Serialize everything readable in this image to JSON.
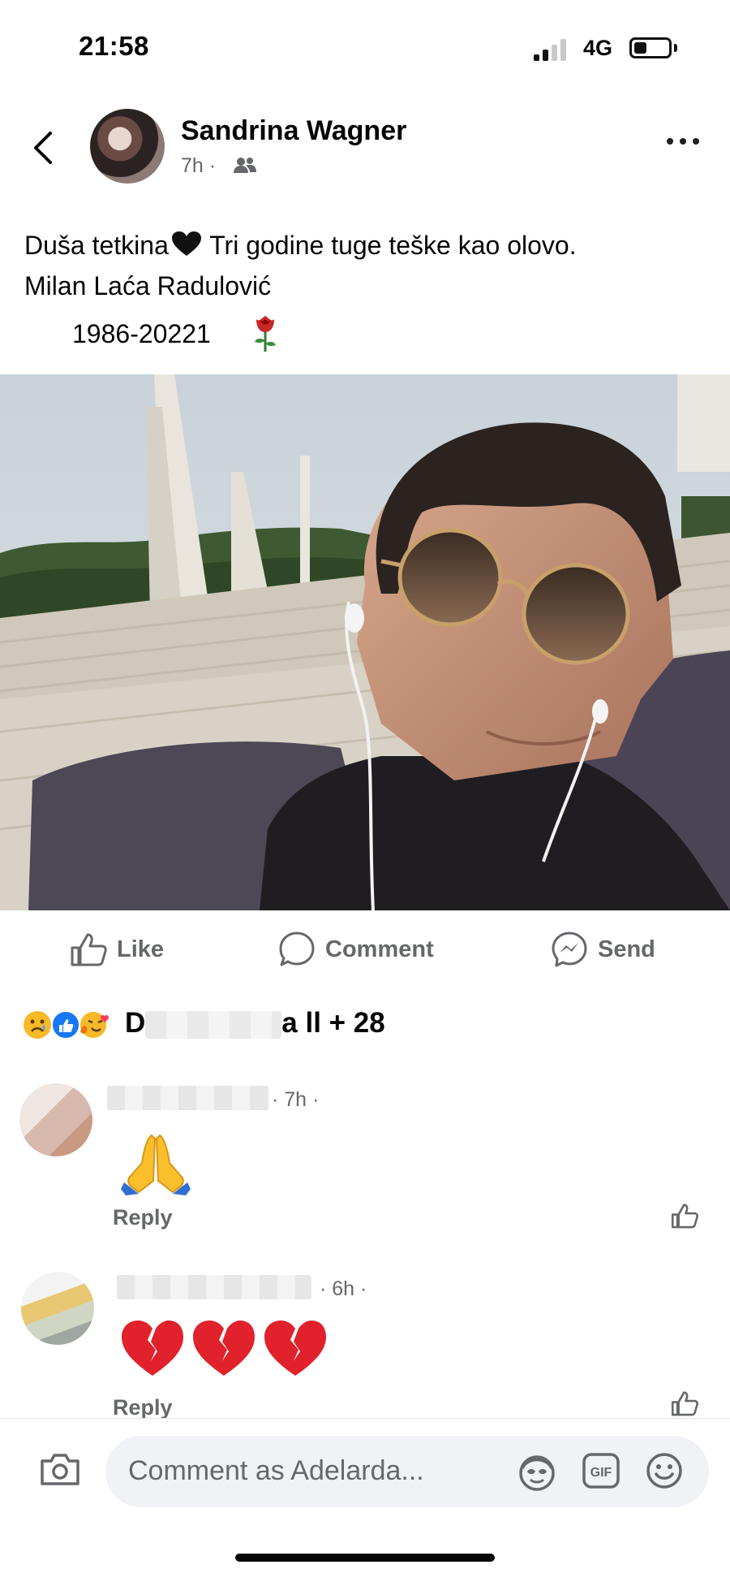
{
  "status_bar": {
    "time": "21:58",
    "network": "4G",
    "signal_bars": 2,
    "battery_level": 0.3
  },
  "post": {
    "author": "Sandrina Wagner",
    "time": "7h",
    "text_line1": "Duša tetkina",
    "text_line1_rest": " Tri godine tuge teške kao olovo.",
    "text_line2": "Milan Laća Radulović",
    "text_line3": "1986-20221"
  },
  "actions": {
    "like": "Like",
    "comment": "Comment",
    "send": "Send"
  },
  "reactions": {
    "names_start": "D",
    "names_end": "a ll + 28"
  },
  "comments": [
    {
      "time": "· 7h ·",
      "reply": "Reply"
    },
    {
      "time": "· 6h ·",
      "reply": "Reply"
    }
  ],
  "composer": {
    "placeholder": "Comment as Adelarda..."
  },
  "colors": {
    "secondary_text": "#65676b",
    "composer_bg": "#f0f2f5",
    "facebook_blue": "#1877f2"
  },
  "icons": [
    "back-icon",
    "audience-friends-icon",
    "more-icon",
    "like-icon",
    "comment-icon",
    "messenger-send-icon",
    "camera-icon",
    "avatar-sticker-icon",
    "gif-icon",
    "emoji-icon"
  ]
}
